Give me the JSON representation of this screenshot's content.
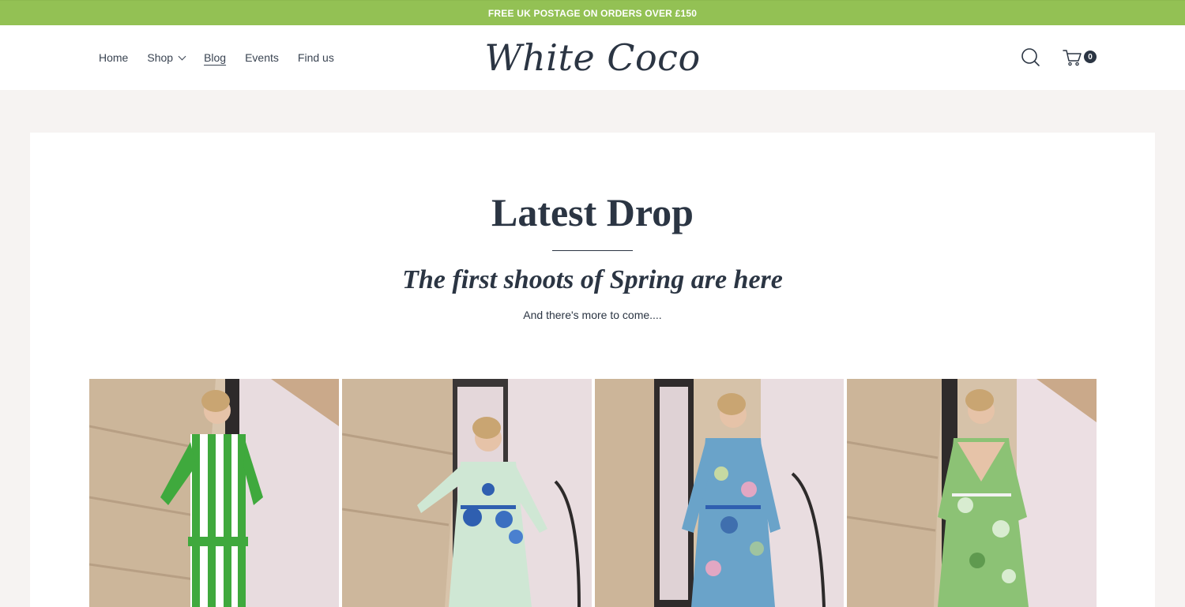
{
  "promo": {
    "text": "FREE UK POSTAGE ON ORDERS OVER £150"
  },
  "nav": {
    "items": [
      {
        "label": "Home"
      },
      {
        "label": "Shop"
      },
      {
        "label": "Blog"
      },
      {
        "label": "Events"
      },
      {
        "label": "Find us"
      }
    ]
  },
  "brand": {
    "logo_text": "White Coco"
  },
  "cart": {
    "count": "0"
  },
  "icons": {
    "search": "search-icon",
    "cart": "cart-icon",
    "dropdown": "chevron-down-icon"
  },
  "main": {
    "title": "Latest Drop",
    "subtitle": "The first shoots of Spring are here",
    "tagline": "And there's more to come...."
  },
  "gallery": [
    {
      "name": "green-striped-shirt-dress"
    },
    {
      "name": "mint-embroidered-maxi-dress"
    },
    {
      "name": "blue-floral-print-dress"
    },
    {
      "name": "green-floral-v-neck-dress"
    }
  ],
  "colors": {
    "promo_bg": "#93c154",
    "text": "#2b3543",
    "page_bg": "#f6f3f2"
  }
}
